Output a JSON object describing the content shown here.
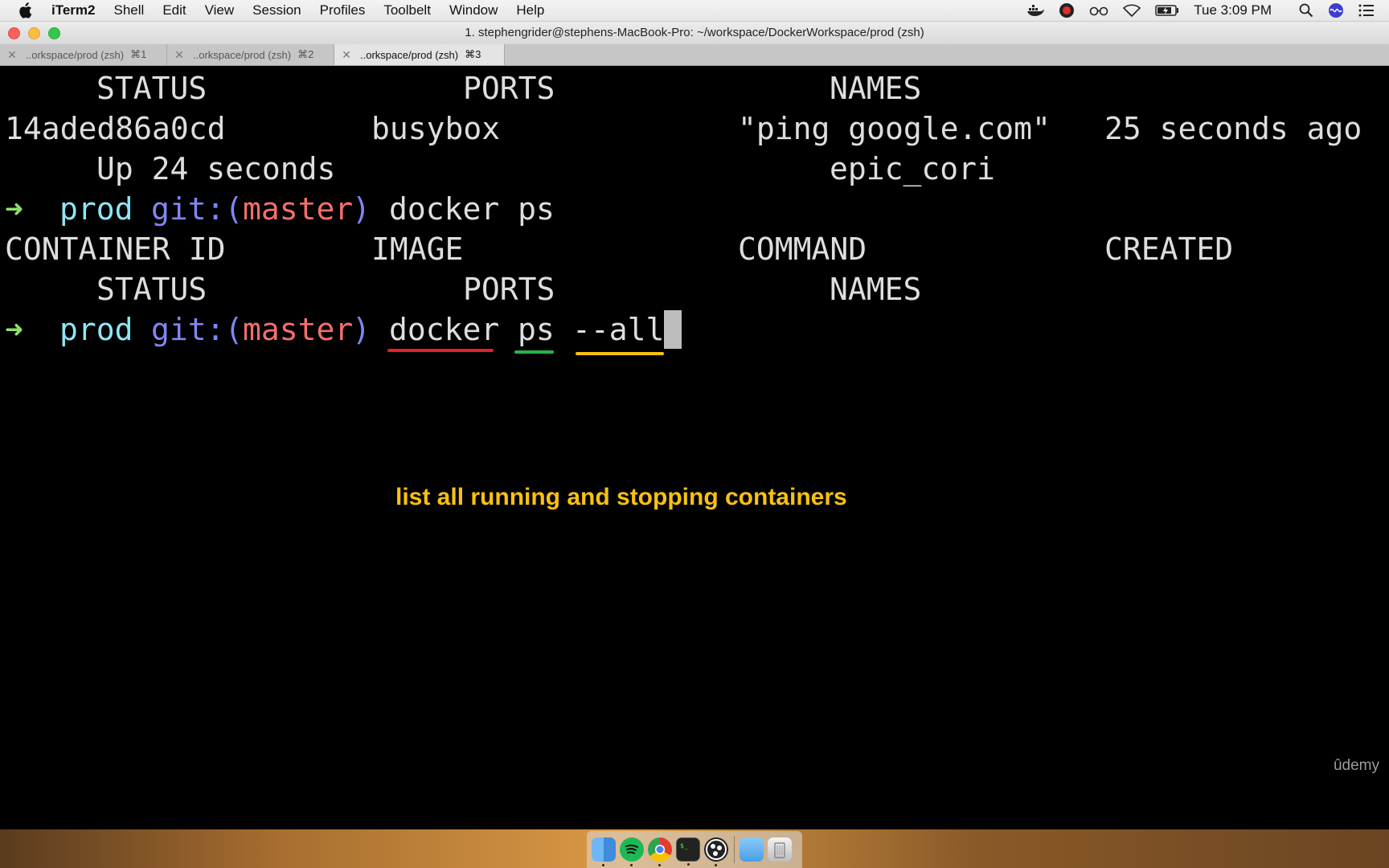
{
  "menubar": {
    "app_name": "iTerm2",
    "items": [
      "Shell",
      "Edit",
      "View",
      "Session",
      "Profiles",
      "Toolbelt",
      "Window",
      "Help"
    ],
    "clock": "Tue 3:09 PM"
  },
  "window": {
    "title": "1. stephengrider@stephens-MacBook-Pro: ~/workspace/DockerWorkspace/prod (zsh)"
  },
  "tabs": [
    {
      "label": "..orkspace/prod (zsh)",
      "shortcut": "⌘1"
    },
    {
      "label": "..orkspace/prod (zsh)",
      "shortcut": "⌘2"
    },
    {
      "label": "..orkspace/prod (zsh)",
      "shortcut": "⌘3"
    }
  ],
  "terminal": {
    "line1": {
      "status": "STATUS",
      "ports": "PORTS",
      "names": "NAMES"
    },
    "line2": {
      "id": "14aded86a0cd",
      "image": "busybox",
      "command": "\"ping google.com\"",
      "created": "25 seconds ago"
    },
    "line3": {
      "status": "Up 24 seconds",
      "names": "epic_cori"
    },
    "prompt1": {
      "arrow": "➜",
      "dir": "prod",
      "git_open": "git:(",
      "branch": "master",
      "git_close": ")",
      "command": "docker ps"
    },
    "header": {
      "id": "CONTAINER ID",
      "image": "IMAGE",
      "command": "COMMAND",
      "created": "CREATED"
    },
    "header2": {
      "status": "STATUS",
      "ports": "PORTS",
      "names": "NAMES"
    },
    "prompt2": {
      "arrow": "➜",
      "dir": "prod",
      "git_open": "git:(",
      "branch": "master",
      "git_close": ")",
      "cmd1": "docker",
      "cmd2": "ps",
      "cmd3": "--all"
    }
  },
  "annotation": "list all running and stopping containers",
  "watermark": "ûdemy",
  "colors": {
    "underline_docker": "#e3222a",
    "underline_ps": "#2ab548",
    "underline_all": "#f9c10f",
    "annotation": "#f9c10f"
  }
}
